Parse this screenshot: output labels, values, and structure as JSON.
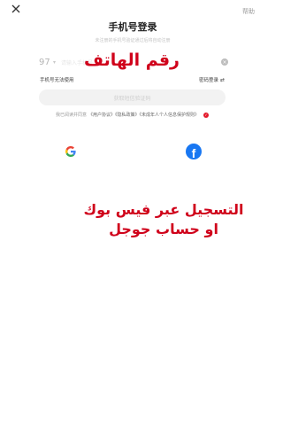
{
  "header": {
    "close_icon": "close-icon",
    "help_label": "帮助"
  },
  "login": {
    "title": "手机号登录",
    "subtitle": "未注册的手机号验证通过后将自动注册",
    "country_code": "97",
    "phone_placeholder": "请输入手机号",
    "no_phone_link": "手机号无法使用",
    "password_login_link": "密码登录",
    "submit_label": "获取短信验证码",
    "terms": {
      "prefix": "我已阅读并同意",
      "links": "《用户协议》《隐私政策》《未成年人个人信息保护规则》"
    }
  },
  "social": {
    "google_icon": "google-icon",
    "facebook_icon": "facebook-icon"
  },
  "overlay": {
    "phone_label": "رقم الهاتف",
    "line1": "التسجيل عبر فيس بوك",
    "line2": "او حساب جوجل",
    "color": "#d0021b"
  }
}
